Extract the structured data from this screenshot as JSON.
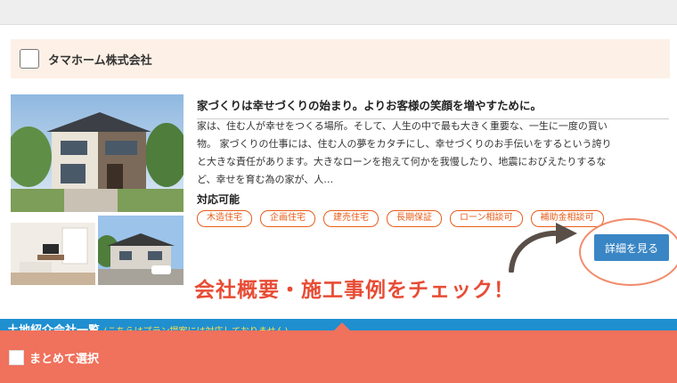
{
  "company": {
    "name": "タマホーム株式会社"
  },
  "listing": {
    "headline": "家づくりは幸せづくりの始まり。よりお客様の笑顔を増やすために。",
    "description_lines": [
      "家は、住む人が幸せをつくる場所。そして、人生の中で最も大きく重要な、一生に一度の買い",
      "物。 家づくりの仕事には、住む人の夢をカタチにし、幸せづくりのお手伝いをするという誇り",
      "と大きな責任があります。大きなローンを抱えて何かを我慢したり、地震におびえたりするな",
      "ど、幸せを育む為の家が、人…"
    ],
    "available_label": "対応可能",
    "tags": [
      "木造住宅",
      "企画住宅",
      "建売住宅",
      "長期保証",
      "ローン相談可",
      "補助金相談可"
    ],
    "detail_button": "詳細を見る"
  },
  "annotation": {
    "text": "会社概要・施工事例をチェック！"
  },
  "section": {
    "title": "土地紹介会社一覧",
    "note": "(こちらはプラン提案には対応しておりません)"
  },
  "bottom_bar": {
    "select_all_label": "まとめて選択"
  },
  "colors": {
    "accent_orange": "#e85d1a",
    "button_blue": "#3a86c5",
    "bottom_bar": "#f0715c",
    "annotation_red": "#e84c35",
    "section_blue": "#1f8fd0"
  }
}
